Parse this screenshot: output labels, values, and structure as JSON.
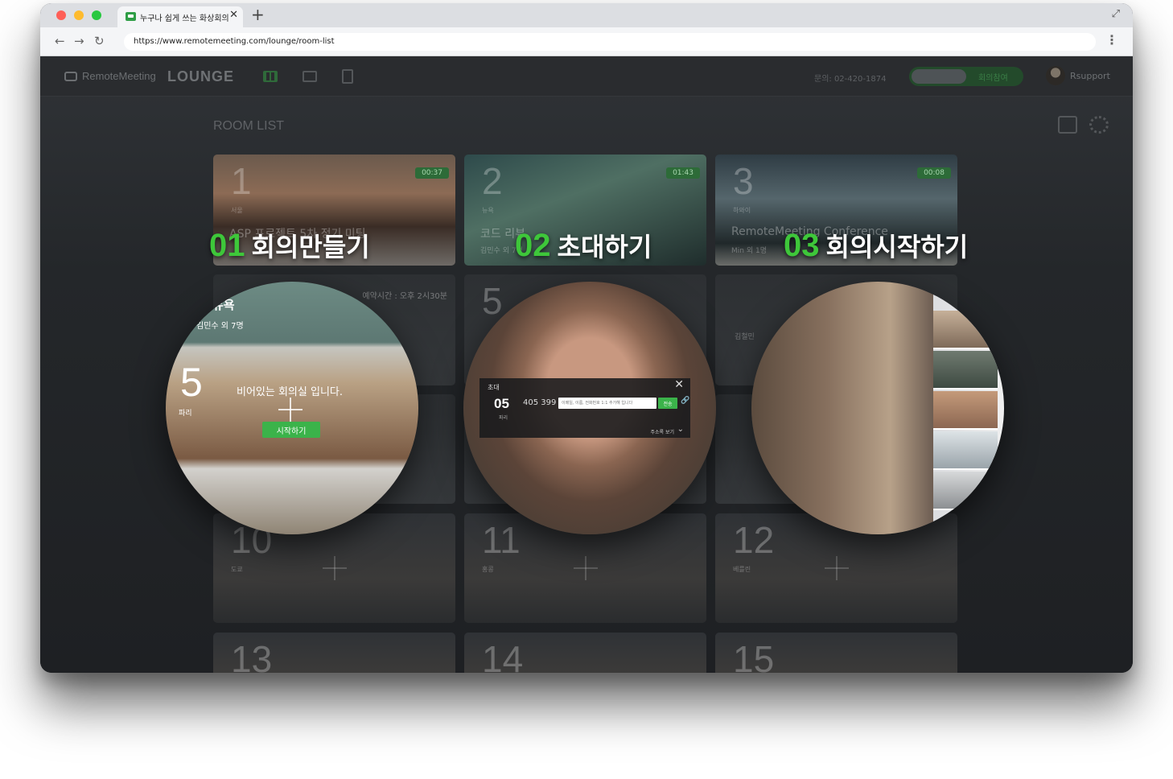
{
  "browser": {
    "tab_title": "누구나 쉽게 쓰는 화상회의",
    "url": "https://www.remotemeeting.com/lounge/room-list"
  },
  "header": {
    "logo": "RemoteMeeting",
    "lounge": "LOUNGE",
    "phone": "문의: 02-420-1874",
    "join_label": "회의참여",
    "user_name": "Rsupport"
  },
  "room_list_title": "ROOM LIST",
  "rooms": [
    {
      "num": "1",
      "city": "서울",
      "name": "ASP 프로젝트 5차 정기 미팅",
      "time": "00:37"
    },
    {
      "num": "2",
      "city": "뉴욕",
      "name": "코드 리뷰",
      "host": "김민수 외 7명",
      "time": "01:43"
    },
    {
      "num": "3",
      "city": "하와이",
      "name": "RemoteMeeting Conference",
      "host": "Min 외 1명",
      "time": "00:08"
    },
    {
      "reserve": "예약시간 : 오후 2시30분"
    },
    {
      "num": "5"
    },
    {
      "host": "김철민"
    },
    {
      "num": "10",
      "city": "도쿄"
    },
    {
      "num": "11",
      "city": "홍콩"
    },
    {
      "num": "12",
      "city": "베를린"
    },
    {
      "num": "13"
    },
    {
      "num": "14"
    },
    {
      "num": "15"
    }
  ],
  "features": [
    {
      "num": "01",
      "label": "회의만들기"
    },
    {
      "num": "02",
      "label": "초대하기"
    },
    {
      "num": "03",
      "label": "회의시작하기"
    }
  ],
  "circle1": {
    "top_name": "뉴욕",
    "top_count": "김민수 외 7명",
    "room_num": "5",
    "city": "파리",
    "empty_msg": "비어있는 회의실 입니다.",
    "start_label": "시작하기"
  },
  "invite": {
    "title": "초대",
    "room_num": "05",
    "room_label": "파리",
    "code": "405 399",
    "placeholder": "이메일, 이름, 전화번호 1:1 추가해 입니다",
    "send_label": "전송",
    "addr_label": "주소록 보기"
  }
}
